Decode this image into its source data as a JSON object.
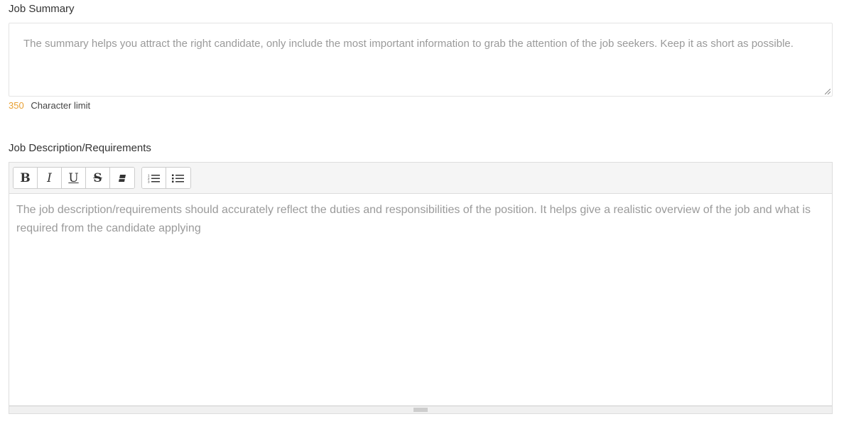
{
  "summary": {
    "label": "Job Summary",
    "placeholder": "The summary helps you attract the right candidate, only include the most important information to grab the attention of the job seekers. Keep it as short as possible.",
    "char_count": "350",
    "char_limit_text": "Character limit"
  },
  "description": {
    "label": "Job Description/Requirements",
    "placeholder": "The job description/requirements should accurately reflect the duties and responsibilities of the position. It helps give a realistic overview of the job and what is required from the candidate applying",
    "toolbar": {
      "bold": "B",
      "italic": "I",
      "underline": "U",
      "strikethrough": "S",
      "clear_format_icon": "eraser-icon",
      "ordered_list_icon": "ordered-list-icon",
      "unordered_list_icon": "unordered-list-icon"
    }
  },
  "colors": {
    "char_count": "#e8a033",
    "placeholder": "#9a9a9a",
    "label": "#333333"
  }
}
